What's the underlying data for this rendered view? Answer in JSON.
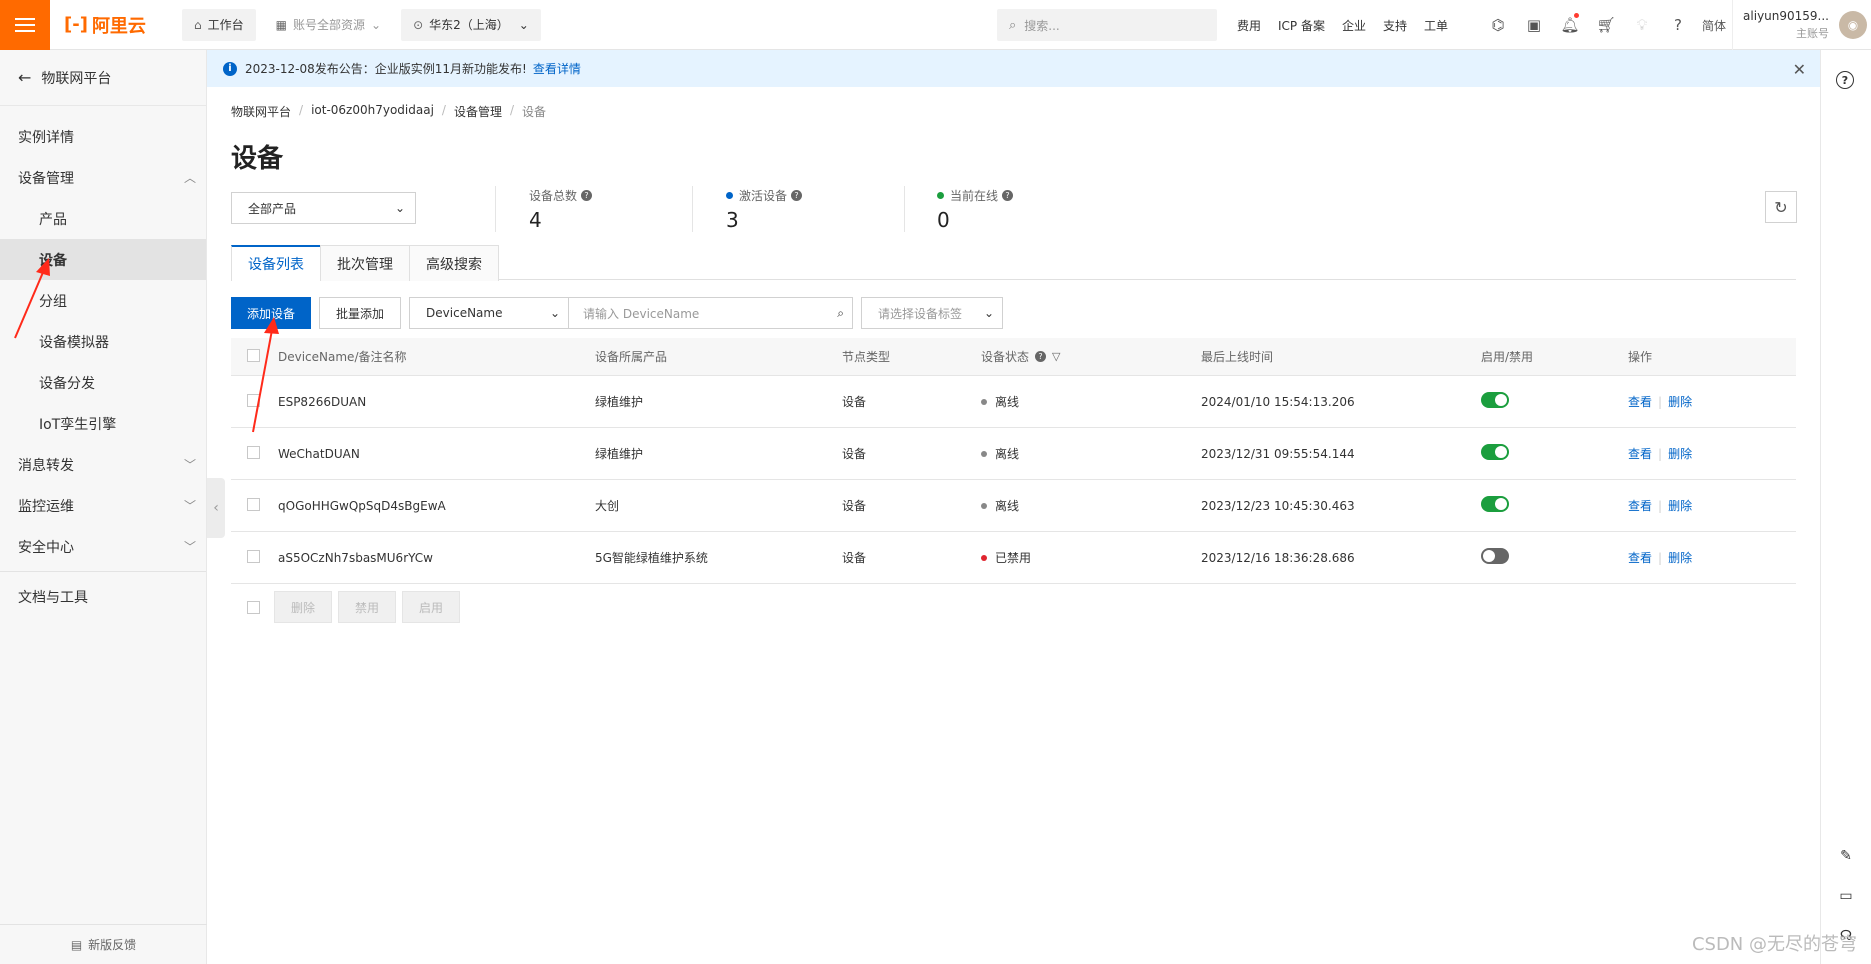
{
  "topbar": {
    "logo": "阿里云",
    "workbench": "工作台",
    "account_scope": "账号全部资源",
    "region": "华东2（上海）",
    "search_placeholder": "搜索...",
    "links": [
      "费用",
      "ICP 备案",
      "企业",
      "支持",
      "工单"
    ],
    "lang": "简体",
    "user_name": "aliyun90159...",
    "user_role": "主账号"
  },
  "sidebar": {
    "back_label": "物联网平台",
    "items": [
      {
        "label": "实例详情",
        "type": "top"
      },
      {
        "label": "设备管理",
        "type": "group",
        "expanded": true
      },
      {
        "label": "产品",
        "type": "sub"
      },
      {
        "label": "设备",
        "type": "sub",
        "active": true
      },
      {
        "label": "分组",
        "type": "sub"
      },
      {
        "label": "设备模拟器",
        "type": "sub"
      },
      {
        "label": "设备分发",
        "type": "sub"
      },
      {
        "label": "IoT孪生引擎",
        "type": "sub"
      },
      {
        "label": "消息转发",
        "type": "group"
      },
      {
        "label": "监控运维",
        "type": "group"
      },
      {
        "label": "安全中心",
        "type": "group"
      },
      {
        "label": "文档与工具",
        "type": "top"
      }
    ],
    "feedback": "新版反馈"
  },
  "banner": {
    "text": "2023-12-08发布公告：企业版实例11月新功能发布!",
    "link": "查看详情"
  },
  "breadcrumb": [
    "物联网平台",
    "iot-06z00h7yodidaaj",
    "设备管理",
    "设备"
  ],
  "page_title": "设备",
  "product_select": "全部产品",
  "stats": [
    {
      "label": "设备总数",
      "value": "4",
      "dot": ""
    },
    {
      "label": "激活设备",
      "value": "3",
      "dot": "#0064c8"
    },
    {
      "label": "当前在线",
      "value": "0",
      "dot": "#1b9e3e"
    }
  ],
  "tabs": [
    "设备列表",
    "批次管理",
    "高级搜索"
  ],
  "toolbar": {
    "add_device": "添加设备",
    "batch_add": "批量添加",
    "search_field": "DeviceName",
    "search_placeholder": "请输入 DeviceName",
    "tag_placeholder": "请选择设备标签"
  },
  "table": {
    "headers": [
      "DeviceName/备注名称",
      "设备所属产品",
      "节点类型",
      "设备状态",
      "最后上线时间",
      "启用/禁用",
      "操作"
    ],
    "rows": [
      {
        "name": "ESP8266DUAN",
        "product": "绿植维护",
        "node": "设备",
        "status": "离线",
        "status_color": "#888888",
        "last_online": "2024/01/10 15:54:13.206",
        "enabled": true
      },
      {
        "name": "WeChatDUAN",
        "product": "绿植维护",
        "node": "设备",
        "status": "离线",
        "status_color": "#888888",
        "last_online": "2023/12/31 09:55:54.144",
        "enabled": true
      },
      {
        "name": "qOGoHHGwQpSqD4sBgEwA",
        "product": "大创",
        "node": "设备",
        "status": "离线",
        "status_color": "#888888",
        "last_online": "2023/12/23 10:45:30.463",
        "enabled": true
      },
      {
        "name": "aS5OCzNh7sbasMU6rYCw",
        "product": "5G智能绿植维护系统",
        "node": "设备",
        "status": "已禁用",
        "status_color": "#e0252f",
        "last_online": "2023/12/16 18:36:28.686",
        "enabled": false
      }
    ],
    "op_view": "查看",
    "op_delete": "删除"
  },
  "bulk_actions": [
    "删除",
    "禁用",
    "启用"
  ],
  "watermark": "CSDN @无尽的苍穹",
  "colors": {
    "accent": "#0064c8",
    "brand": "#ff6a00",
    "annotation": "#ff2a1a"
  }
}
